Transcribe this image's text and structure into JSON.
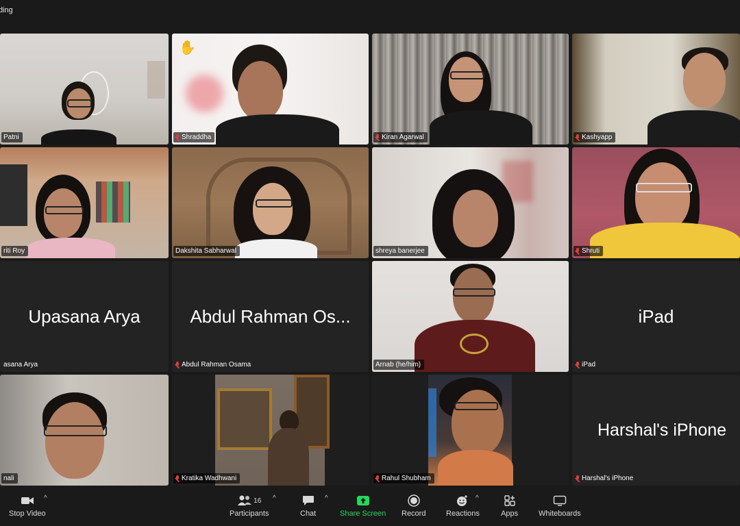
{
  "topbar": {
    "recording_label": "ding"
  },
  "participants": [
    {
      "name": "Patni",
      "mic": false,
      "display": "video"
    },
    {
      "name": "Shraddha",
      "mic": true,
      "display": "video",
      "raised_hand": true
    },
    {
      "name": "Kiran Agarwal",
      "mic": true,
      "display": "video"
    },
    {
      "name": "Kashyapp",
      "mic": true,
      "display": "video"
    },
    {
      "name": "riti Roy",
      "mic": false,
      "display": "video"
    },
    {
      "name": "Dakshita Sabharwal",
      "mic": false,
      "display": "video"
    },
    {
      "name": "shreya banerjee",
      "mic": false,
      "display": "video"
    },
    {
      "name": "Shruti",
      "mic": true,
      "display": "video"
    },
    {
      "name": "asana Arya",
      "mic": false,
      "display": "name",
      "big_name": "Upasana Arya"
    },
    {
      "name": "Abdul Rahman Osama",
      "mic": true,
      "display": "name",
      "big_name": "Abdul Rahman Os..."
    },
    {
      "name": "Arnab   (he/him)",
      "mic": false,
      "display": "video",
      "active_speaker": true
    },
    {
      "name": "iPad",
      "mic": true,
      "display": "name",
      "big_name": "iPad"
    },
    {
      "name": "nali",
      "mic": false,
      "display": "video"
    },
    {
      "name": "Kratika Wadhwani",
      "mic": true,
      "display": "video"
    },
    {
      "name": "Rahul Shubham",
      "mic": true,
      "display": "video"
    },
    {
      "name": "Harshal's iPhone",
      "mic": true,
      "display": "name",
      "big_name": "Harshal's iPhone"
    }
  ],
  "toolbar": {
    "stop_video": "Stop Video",
    "participants": "Participants",
    "participants_count": "16",
    "chat": "Chat",
    "share_screen": "Share Screen",
    "record": "Record",
    "reactions": "Reactions",
    "apps": "Apps",
    "whiteboards": "Whiteboards",
    "caret": "^"
  },
  "colors": {
    "accent_green": "#23d959",
    "muted_red": "#e23b3b",
    "hand_yellow": "#f5b62b"
  }
}
